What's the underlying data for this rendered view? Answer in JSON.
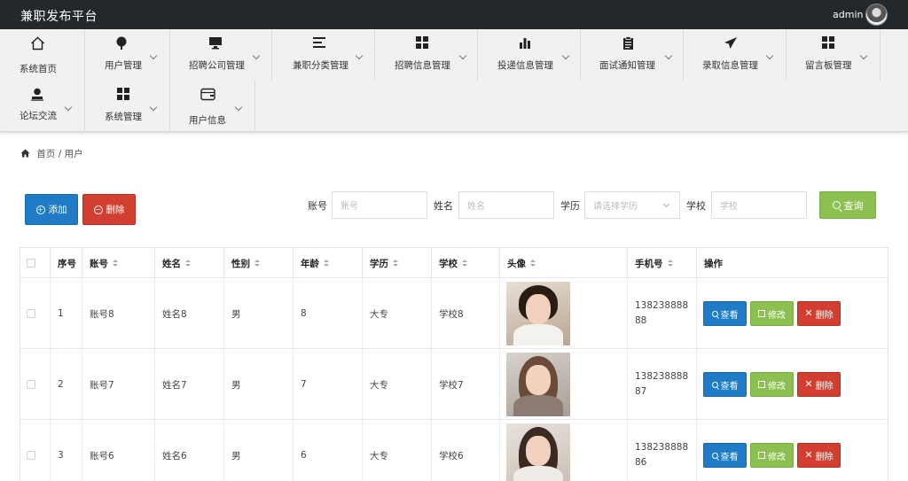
{
  "app": {
    "title": "兼职发布平台",
    "user": "admin"
  },
  "nav": {
    "items": [
      {
        "label": "系统首页",
        "icon": "home-icon"
      },
      {
        "label": "用户管理",
        "icon": "pin-icon"
      },
      {
        "label": "招聘公司管理",
        "icon": "monitor-icon"
      },
      {
        "label": "兼职分类管理",
        "icon": "menu-lines-icon"
      },
      {
        "label": "招聘信息管理",
        "icon": "grid-icon"
      },
      {
        "label": "投递信息管理",
        "icon": "bar-chart-icon"
      },
      {
        "label": "面试通知管理",
        "icon": "clipboard-icon"
      },
      {
        "label": "录取信息管理",
        "icon": "send-icon"
      },
      {
        "label": "留言板管理",
        "icon": "grid-icon"
      },
      {
        "label": "论坛交流",
        "icon": "user-icon"
      },
      {
        "label": "系统管理",
        "icon": "grid-icon"
      },
      {
        "label": "用户信息",
        "icon": "wallet-icon"
      }
    ]
  },
  "breadcrumb": {
    "home": "首页",
    "sep": "/",
    "current": "用户"
  },
  "toolbar": {
    "add": "添加",
    "delete": "删除",
    "query": "查询"
  },
  "filters": {
    "account": {
      "label": "账号",
      "placeholder": "账号"
    },
    "name": {
      "label": "姓名",
      "placeholder": "姓名"
    },
    "education": {
      "label": "学历",
      "placeholder": "请选择学历"
    },
    "school": {
      "label": "学校",
      "placeholder": "学校"
    }
  },
  "table": {
    "headers": {
      "index": "序号",
      "account": "账号",
      "name": "姓名",
      "gender": "性别",
      "age": "年龄",
      "education": "学历",
      "school": "学校",
      "avatar": "头像",
      "phone": "手机号",
      "actions": "操作"
    },
    "rows": [
      {
        "index": "1",
        "account": "账号8",
        "name": "姓名8",
        "gender": "男",
        "age": "8",
        "education": "大专",
        "school": "学校8",
        "phone": "13823888888"
      },
      {
        "index": "2",
        "account": "账号7",
        "name": "姓名7",
        "gender": "男",
        "age": "7",
        "education": "大专",
        "school": "学校7",
        "phone": "13823888887"
      },
      {
        "index": "3",
        "account": "账号6",
        "name": "姓名6",
        "gender": "男",
        "age": "6",
        "education": "大专",
        "school": "学校6",
        "phone": "13823888886"
      }
    ],
    "actions": {
      "view": "查看",
      "edit": "修改",
      "delete": "删除"
    }
  },
  "colors": {
    "topbar": "#23282d",
    "primary": "#1f7bc6",
    "success": "#8cc152",
    "danger": "#d23f31"
  }
}
